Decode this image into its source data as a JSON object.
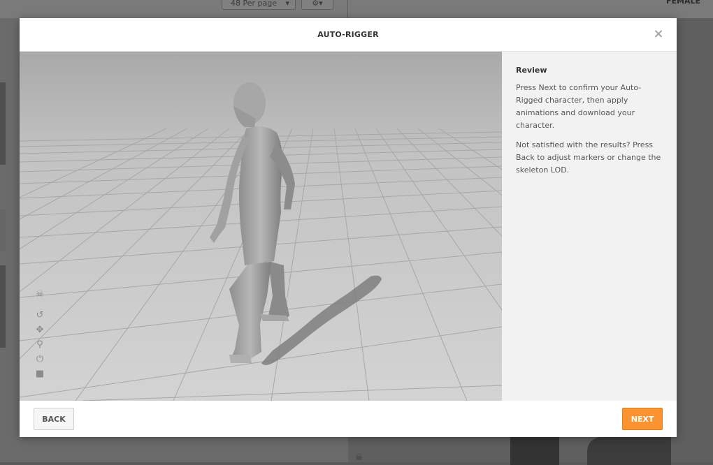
{
  "background": {
    "per_page_label": "48 Per page",
    "per_page_caret": "▾",
    "gear_label": "⚙▾",
    "filter_label": "FEMALE"
  },
  "modal": {
    "title": "AUTO-RIGGER",
    "close_glyph": "×"
  },
  "panel": {
    "heading": "Review",
    "paragraphs": [
      "Press Next to confirm your Auto-Rigged character, then apply animations and download your character.",
      "Not satisfied with the results? Press Back to adjust markers or change the skeleton LOD."
    ]
  },
  "viewport_tools": [
    {
      "name": "skeleton-icon",
      "glyph": "☠"
    },
    {
      "name": "rotate-icon",
      "glyph": "↺"
    },
    {
      "name": "move-icon",
      "glyph": "✥"
    },
    {
      "name": "zoom-icon",
      "glyph": "⚲"
    },
    {
      "name": "reset-icon",
      "glyph": "⏻"
    },
    {
      "name": "camera-icon",
      "glyph": "■"
    }
  ],
  "footer": {
    "back_label": "BACK",
    "next_label": "NEXT"
  },
  "colors": {
    "accent": "#fb9430",
    "overlay": "#595959"
  }
}
